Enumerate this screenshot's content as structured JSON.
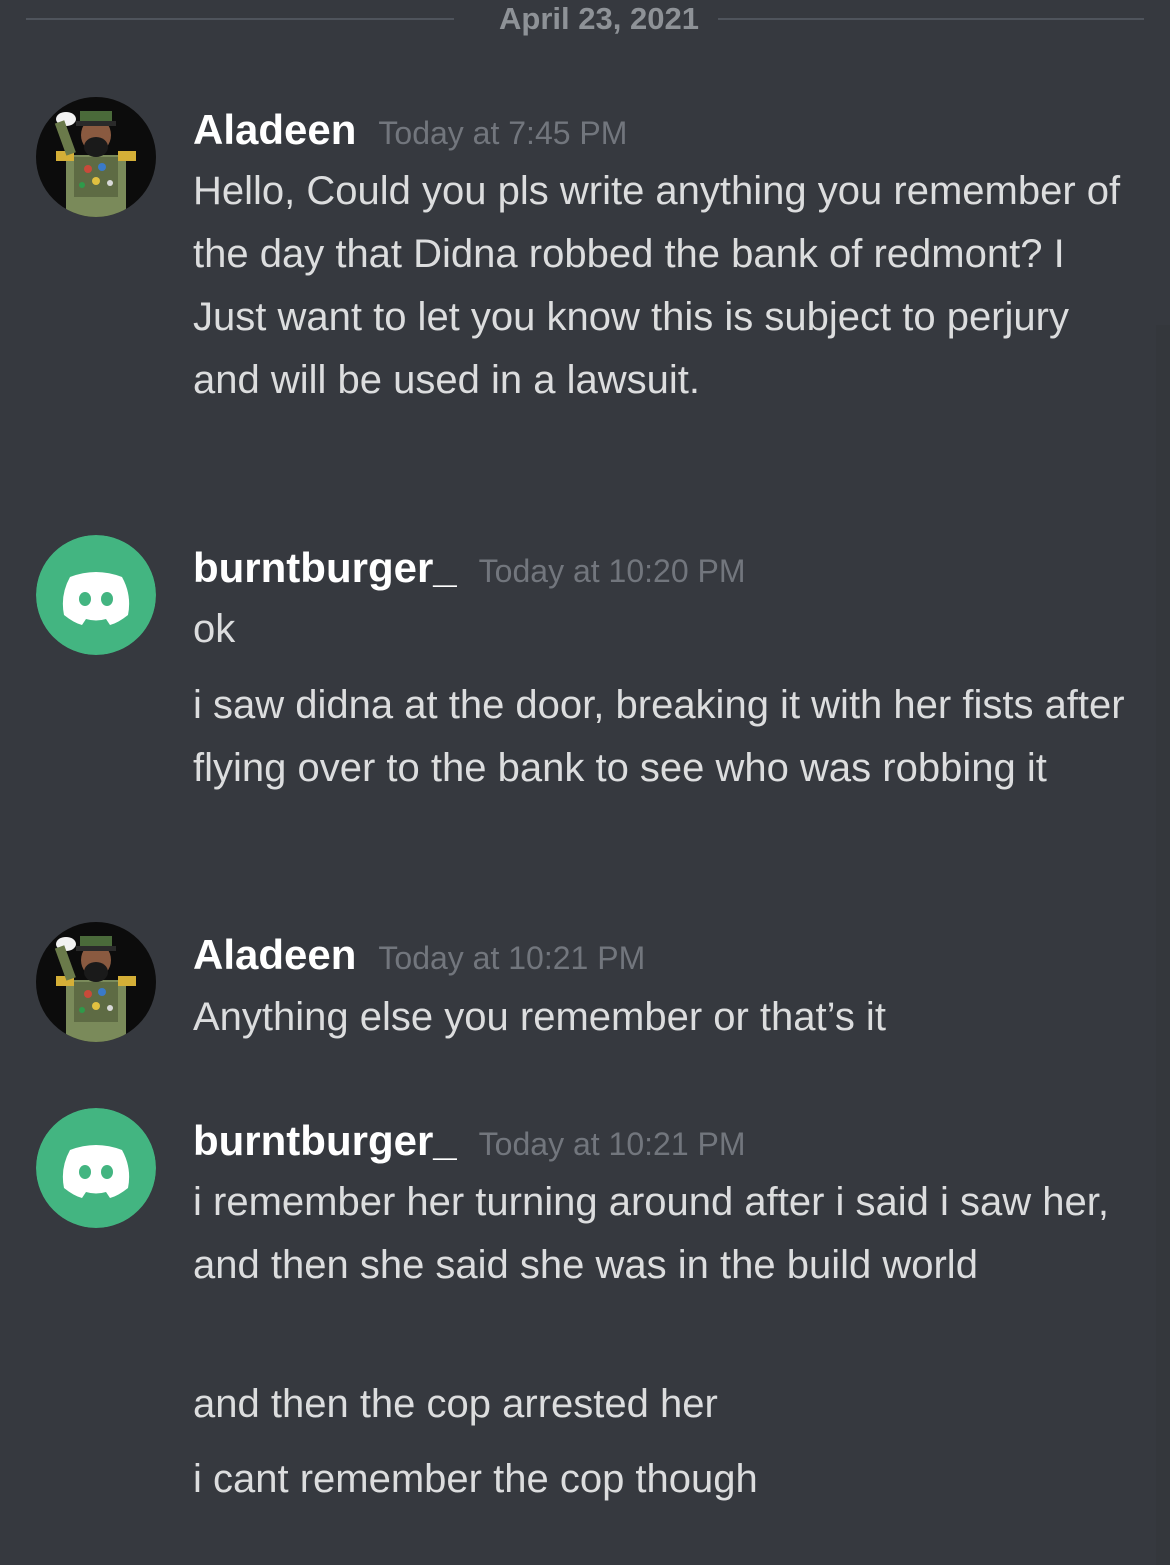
{
  "date_divider": "April 23, 2021",
  "colors": {
    "background": "#36393f",
    "username": "#ffffff",
    "timestamp": "#72767d",
    "message_text": "#dcddde",
    "divider": "#4f545c",
    "default_avatar": "#43b581"
  },
  "messages": [
    {
      "author": "Aladeen",
      "avatar": "profile-photo",
      "timestamp": "Today at 7:45 PM",
      "lines": [
        "Hello, Could you pls write anything you remember of the day that Didna robbed the bank of redmont? I Just want to let you know this is subject to perjury and will be used in a lawsuit."
      ]
    },
    {
      "author": "burntburger_",
      "avatar": "discord-default-icon",
      "timestamp": "Today at 10:20 PM",
      "lines": [
        "ok",
        "i saw didna at the door, breaking it with her fists after flying over to the bank to see who was robbing it"
      ]
    },
    {
      "author": "Aladeen",
      "avatar": "profile-photo",
      "timestamp": "Today at 10:21 PM",
      "lines": [
        "Anything else you remember or that’s it"
      ]
    },
    {
      "author": "burntburger_",
      "avatar": "discord-default-icon",
      "timestamp": "Today at 10:21 PM",
      "lines": [
        "i remember her turning around after i said i saw her, and then she said she was in the build world",
        "and then the cop arrested her",
        "i cant remember the cop though"
      ]
    }
  ]
}
